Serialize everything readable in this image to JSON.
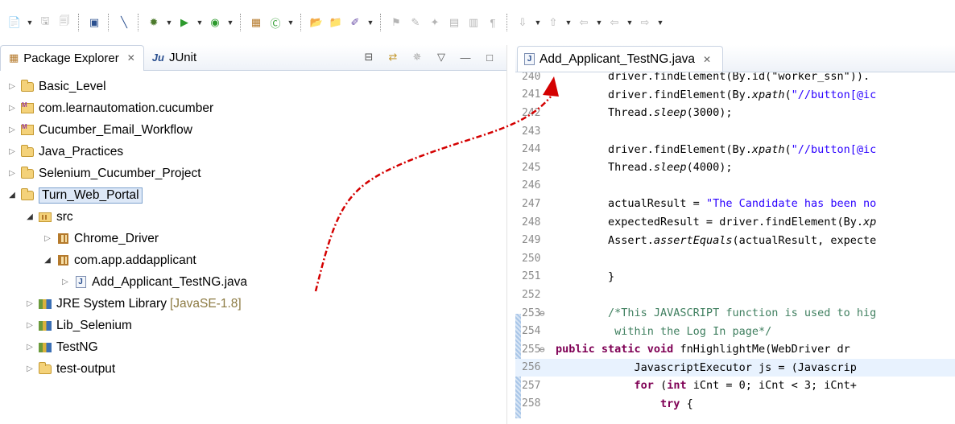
{
  "left_panel": {
    "tabs": [
      {
        "label": "Package Explorer",
        "active": true
      },
      {
        "label": "JUnit",
        "active": false
      }
    ],
    "tree": [
      {
        "label": "Basic_Level",
        "icon": "folder-icon",
        "depth": 0,
        "expanded": false
      },
      {
        "label": "com.learnautomation.cucumber",
        "icon": "maven-project-icon",
        "depth": 0,
        "expanded": false
      },
      {
        "label": "Cucumber_Email_Workflow",
        "icon": "maven-project-icon",
        "depth": 0,
        "expanded": false
      },
      {
        "label": "Java_Practices",
        "icon": "folder-icon",
        "depth": 0,
        "expanded": false
      },
      {
        "label": "Selenium_Cucumber_Project",
        "icon": "folder-icon",
        "depth": 0,
        "expanded": false
      },
      {
        "label": "Turn_Web_Portal",
        "icon": "folder-icon",
        "depth": 0,
        "expanded": true,
        "selected": true
      },
      {
        "label": "src",
        "icon": "source-folder-icon",
        "depth": 1,
        "expanded": true
      },
      {
        "label": "Chrome_Driver",
        "icon": "package-icon",
        "depth": 2,
        "expanded": false
      },
      {
        "label": "com.app.addapplicant",
        "icon": "package-icon",
        "depth": 2,
        "expanded": true
      },
      {
        "label": "Add_Applicant_TestNG.java",
        "icon": "java-file-icon",
        "depth": 3,
        "expanded": false
      },
      {
        "label": "JRE System Library",
        "suffix": "[JavaSE-1.8]",
        "icon": "library-icon",
        "depth": 1,
        "expanded": false
      },
      {
        "label": "Lib_Selenium",
        "icon": "library-icon",
        "depth": 1,
        "expanded": false
      },
      {
        "label": "TestNG",
        "icon": "library-icon",
        "depth": 1,
        "expanded": false
      },
      {
        "label": "test-output",
        "icon": "folder-icon",
        "depth": 1,
        "expanded": false
      }
    ]
  },
  "editor": {
    "tab_label": "Add_Applicant_TestNG.java",
    "lines": [
      {
        "n": "240",
        "parts": [
          [
            "        driver.findElement(By.id(\"worker_ssn\")).",
            ""
          ]
        ]
      },
      {
        "n": "241",
        "parts": [
          [
            "        driver.findElement(By.",
            ""
          ],
          [
            "xpath",
            "it"
          ],
          [
            "(",
            ""
          ],
          [
            "\"//button[@ic",
            "str"
          ]
        ]
      },
      {
        "n": "242",
        "parts": [
          [
            "        Thread.",
            ""
          ],
          [
            "sleep",
            "it"
          ],
          [
            "(3000);",
            ""
          ]
        ]
      },
      {
        "n": "243",
        "parts": [
          [
            "",
            ""
          ]
        ]
      },
      {
        "n": "244",
        "parts": [
          [
            "        driver.findElement(By.",
            ""
          ],
          [
            "xpath",
            "it"
          ],
          [
            "(",
            ""
          ],
          [
            "\"//button[@ic",
            "str"
          ]
        ]
      },
      {
        "n": "245",
        "parts": [
          [
            "        Thread.",
            ""
          ],
          [
            "sleep",
            "it"
          ],
          [
            "(4000);",
            ""
          ]
        ]
      },
      {
        "n": "246",
        "parts": [
          [
            "",
            ""
          ]
        ]
      },
      {
        "n": "247",
        "parts": [
          [
            "        actualResult = ",
            ""
          ],
          [
            "\"The Candidate has been no",
            "str"
          ]
        ]
      },
      {
        "n": "248",
        "parts": [
          [
            "        expectedResult = driver.findElement(By.",
            ""
          ],
          [
            "xp",
            "it"
          ]
        ]
      },
      {
        "n": "249",
        "parts": [
          [
            "        Assert.",
            ""
          ],
          [
            "assertEquals",
            "it"
          ],
          [
            "(actualResult, expecte",
            ""
          ]
        ]
      },
      {
        "n": "250",
        "parts": [
          [
            "",
            ""
          ]
        ]
      },
      {
        "n": "251",
        "parts": [
          [
            "        }",
            ""
          ]
        ]
      },
      {
        "n": "252",
        "parts": [
          [
            "",
            ""
          ]
        ]
      },
      {
        "n": "253",
        "fold": true,
        "parts": [
          [
            "        /*This JAVASCRIPT function is used to hig",
            "cmt"
          ]
        ]
      },
      {
        "n": "254",
        "parts": [
          [
            "         within the Log In page*/",
            "cmt"
          ]
        ]
      },
      {
        "n": "255",
        "fold": true,
        "parts": [
          [
            "public static void ",
            "kw"
          ],
          [
            "fnHighlightMe(WebDriver dr",
            ""
          ]
        ]
      },
      {
        "n": "256",
        "highlight": true,
        "parts": [
          [
            "            JavascriptExecutor js = (Javascrip",
            ""
          ]
        ]
      },
      {
        "n": "257",
        "parts": [
          [
            "            ",
            ""
          ],
          [
            "for",
            "kw"
          ],
          [
            " (",
            ""
          ],
          [
            "int",
            "kw"
          ],
          [
            " iCnt = 0; iCnt < 3; iCnt+",
            ""
          ]
        ]
      },
      {
        "n": "258",
        "parts": [
          [
            "                ",
            ""
          ],
          [
            "try",
            "kw"
          ],
          [
            " {",
            ""
          ]
        ]
      }
    ]
  }
}
